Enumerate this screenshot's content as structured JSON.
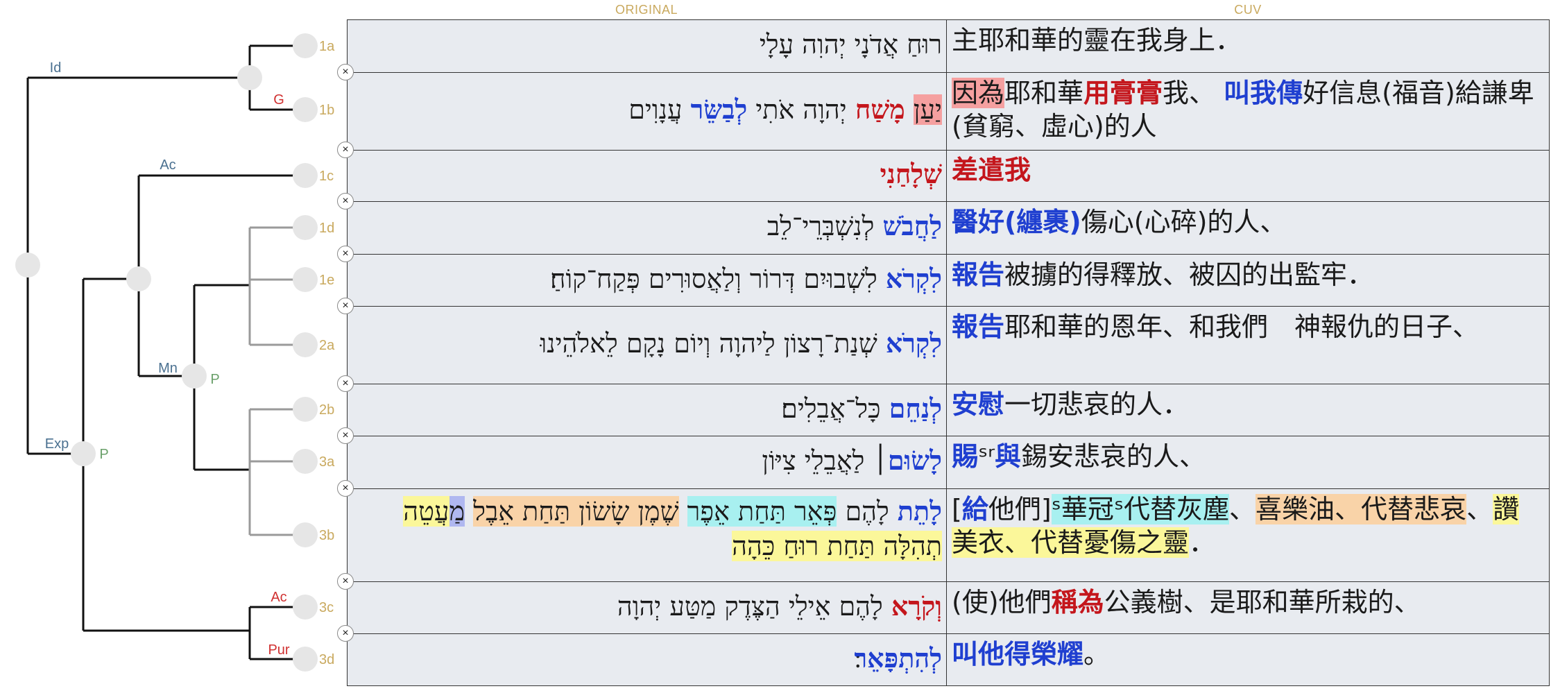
{
  "columns": {
    "original": "ORIGINAL",
    "translation": "CUV"
  },
  "close_glyph": "×",
  "tree_labels": {
    "id": "Id",
    "g": "G",
    "ac1": "Ac",
    "mn": "Mn",
    "p1": "P",
    "exp": "Exp",
    "p2": "P",
    "ac2": "Ac",
    "pur": "Pur"
  },
  "rows": [
    {
      "id": "1a",
      "heb": [
        {
          "t": "רוּחַ אֲדֹנָי יְהוִה עָלָי"
        }
      ],
      "zh": [
        {
          "t": "主耶和華的靈在我身上．"
        }
      ]
    },
    {
      "id": "1b",
      "heb": [
        {
          "t": "יַעַן",
          "c": "bg-pink"
        },
        {
          "t": " "
        },
        {
          "t": "מָשַׁח",
          "c": "hl-red"
        },
        {
          "t": " יְהוָה אֹתִי "
        },
        {
          "t": "לְבַשֵּׂר",
          "c": "hl-blue"
        },
        {
          "t": " עֲנָוִים"
        }
      ],
      "zh": [
        {
          "t": "因為",
          "c": "bg-pink"
        },
        {
          "t": "耶和華"
        },
        {
          "t": "用膏膏",
          "c": "hl-red"
        },
        {
          "t": "我、 "
        },
        {
          "t": "叫我傳",
          "c": "hl-blue"
        },
        {
          "t": "好信息(福音)給謙卑(貧窮、虛心)的人"
        }
      ]
    },
    {
      "id": "1c",
      "heb": [
        {
          "t": "שְׁלָחַנִי",
          "c": "hl-red"
        }
      ],
      "zh": [
        {
          "t": "差遣我",
          "c": "hl-red"
        }
      ]
    },
    {
      "id": "1d",
      "heb": [
        {
          "t": "לַחֲבֹשׁ",
          "c": "hl-blue"
        },
        {
          "t": " לְנִשְׁבְּרֵי־לֵב"
        }
      ],
      "zh": [
        {
          "t": "醫好(纏裹)",
          "c": "hl-blue"
        },
        {
          "t": "傷心(心碎)的人、"
        }
      ]
    },
    {
      "id": "1e",
      "heb": [
        {
          "t": "לִקְרֹא",
          "c": "hl-blue"
        },
        {
          "t": " לִשְׁבוּיִם דְּרוֹר וְלַאֲסוּרִים פְּקַח־קוֹחַ׃"
        }
      ],
      "zh": [
        {
          "t": "報告",
          "c": "hl-blue"
        },
        {
          "t": "被擄的得釋放、被囚的出監牢．"
        }
      ]
    },
    {
      "id": "2a",
      "heb": [
        {
          "t": "לִקְרֹא",
          "c": "hl-blue"
        },
        {
          "t": " שְׁנַת־רָצוֹן לַיהוָה וְיוֹם נָקָם לֵאלֹהֵינוּ"
        }
      ],
      "zh": [
        {
          "t": "報告",
          "c": "hl-blue"
        },
        {
          "t": "耶和華的恩年、和我們　神報仇的日子、"
        }
      ]
    },
    {
      "id": "2b",
      "heb": [
        {
          "t": "לְנַחֵם",
          "c": "hl-blue"
        },
        {
          "t": " כָּל־אֲבֵלִים׃"
        }
      ],
      "zh": [
        {
          "t": "安慰",
          "c": "hl-blue"
        },
        {
          "t": "一切悲哀的人．"
        }
      ]
    },
    {
      "id": "3a",
      "heb": [
        {
          "t": "לָשׂוּם",
          "c": "hl-blue"
        },
        {
          "t": "׀ לַאֲבֵלֵי צִיּוֹן"
        }
      ],
      "zh": [
        {
          "t": "賜",
          "c": "hl-blue"
        },
        {
          "t": "ˢʳ"
        },
        {
          "t": "與",
          "c": "hl-blue"
        },
        {
          "t": "錫安悲哀的人、"
        }
      ]
    },
    {
      "id": "3b",
      "heb": [
        {
          "t": "לָתֵת",
          "c": "hl-blue"
        },
        {
          "t": " לָהֶם "
        },
        {
          "t": "פְּאֵר תַּחַת אֵפֶר",
          "c": "bg-cyan"
        },
        {
          "t": " "
        },
        {
          "t": "שֶׁמֶן שָׂשׂוֹן תַּחַת אֵבֶל",
          "c": "bg-peach"
        },
        {
          "t": " "
        },
        {
          "t": "מ",
          "c": "bg-lav"
        },
        {
          "t": "ַעֲטֵה תְהִלָּה תַּחַת רוּחַ כֵּהָה",
          "c": "bg-yellow"
        }
      ],
      "zh": [
        {
          "t": "["
        },
        {
          "t": "給",
          "c": "hl-blue"
        },
        {
          "t": "他們]"
        },
        {
          "t": "ˢ華冠ˢ代替灰塵",
          "c": "bg-cyan"
        },
        {
          "t": "、"
        },
        {
          "t": "喜樂油、代替悲哀",
          "c": "bg-peach"
        },
        {
          "t": "、"
        },
        {
          "t": "讚美衣、代替憂傷之靈",
          "c": "bg-yellow"
        },
        {
          "t": "．"
        }
      ]
    },
    {
      "id": "3c",
      "heb": [
        {
          "t": "וְקֹרָא",
          "c": "hl-red"
        },
        {
          "t": " לָהֶם אֵילֵי הַצֶּדֶק מַטַּע יְהוָה"
        }
      ],
      "zh": [
        {
          "t": "(使)他們"
        },
        {
          "t": "稱為",
          "c": "hl-red"
        },
        {
          "t": "公義樹、是耶和華所栽的、"
        }
      ]
    },
    {
      "id": "3d",
      "heb": [
        {
          "t": "לְהִתְפָּאֵר",
          "c": "hl-blue"
        },
        {
          "t": "׃"
        }
      ],
      "zh": [
        {
          "t": "叫他得榮耀",
          "c": "hl-blue"
        },
        {
          "t": "。"
        }
      ]
    }
  ]
}
